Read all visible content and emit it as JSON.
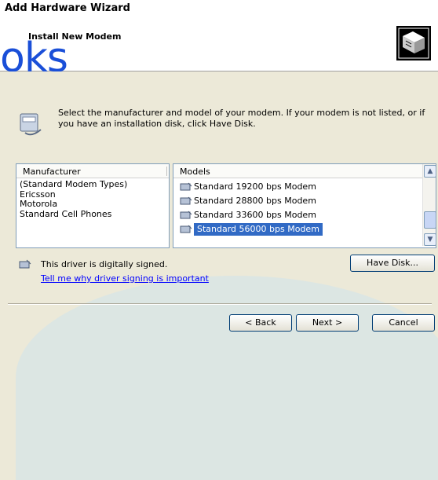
{
  "window": {
    "title": "Add Hardware Wizard"
  },
  "header": {
    "title": "Install New Modem",
    "icon": "hardware-icon"
  },
  "overlay": {
    "text": "oks"
  },
  "instructions": "Select the manufacturer and model of your modem. If your modem is not listed, or if you have an installation disk, click Have Disk.",
  "manufacturer": {
    "header": "Manufacturer",
    "items": [
      "(Standard Modem Types)",
      "Ericsson",
      "Motorola",
      "Standard Cell Phones"
    ]
  },
  "models": {
    "header": "Models",
    "items": [
      "Standard 19200 bps Modem",
      "Standard 28800 bps Modem",
      "Standard 33600 bps Modem",
      "Standard 56000 bps Modem"
    ],
    "selected_index": 3
  },
  "driver": {
    "signed_text": "This driver is digitally signed.",
    "link_text": "Tell me why driver signing is important"
  },
  "buttons": {
    "have_disk": "Have Disk...",
    "back": "< Back",
    "next": "Next >",
    "cancel": "Cancel"
  }
}
